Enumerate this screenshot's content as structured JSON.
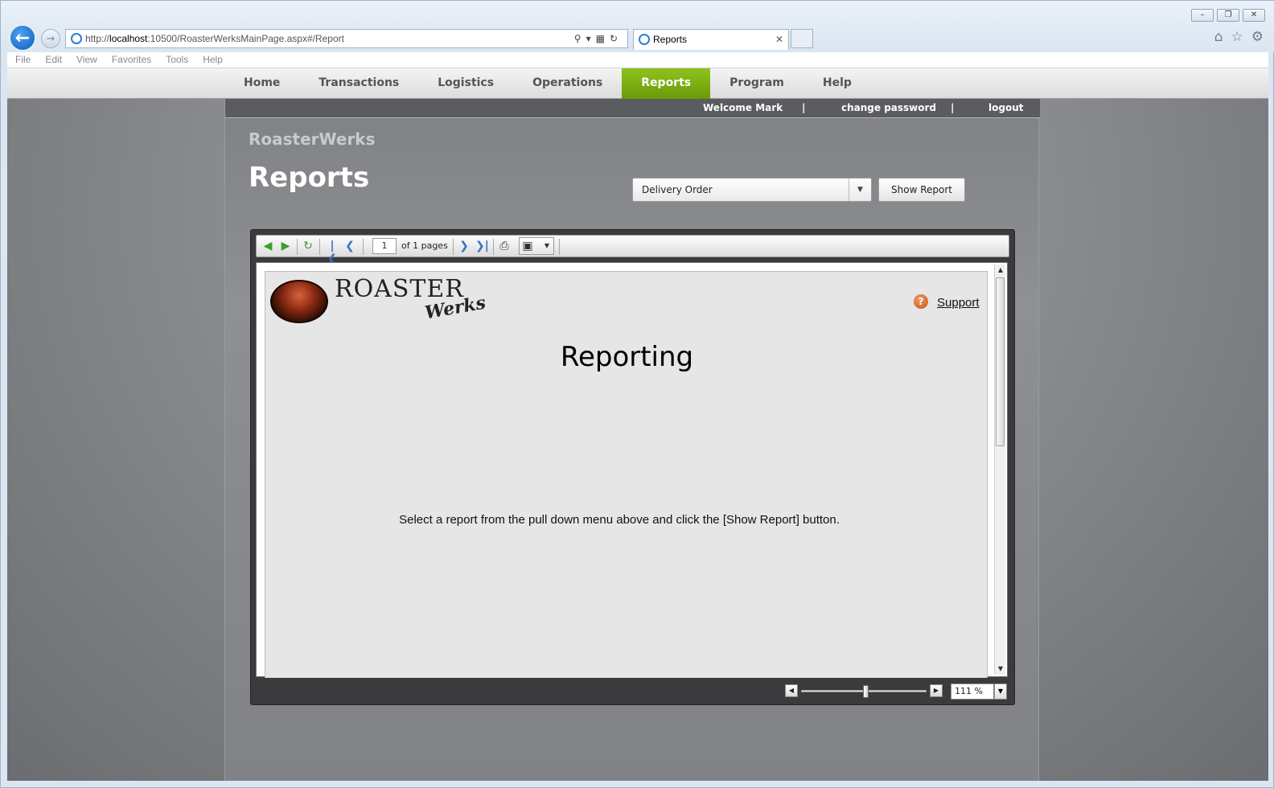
{
  "browser": {
    "url_prefix": "http://",
    "url_host": "localhost",
    "url_rest": ":10500/RoasterWerksMainPage.aspx#/Report",
    "tab_title": "Reports",
    "menu": [
      "File",
      "Edit",
      "View",
      "Favorites",
      "Tools",
      "Help"
    ]
  },
  "nav": {
    "items": [
      "Home",
      "Transactions",
      "Logistics",
      "Operations",
      "Reports",
      "Program",
      "Help"
    ],
    "active": "Reports",
    "accent_color": "#7cab10"
  },
  "userbar": {
    "welcome": "Welcome Mark",
    "sep": "|",
    "change_password": "change password",
    "logout": "logout"
  },
  "header": {
    "brand": "RoasterWerks",
    "title": "Reports"
  },
  "controls": {
    "report_select_value": "Delivery Order",
    "show_report_label": "Show Report"
  },
  "viewer": {
    "page_number": "1",
    "of_pages": "of 1 pages",
    "zoom": "111 %",
    "zoom_fraction": 0.52
  },
  "report": {
    "logo_word1": "ROASTER",
    "logo_word2": "Werks",
    "support_label": "Support",
    "title": "Reporting",
    "instructions": "Select a report from the pull down menu above and click the [Show Report] button."
  }
}
